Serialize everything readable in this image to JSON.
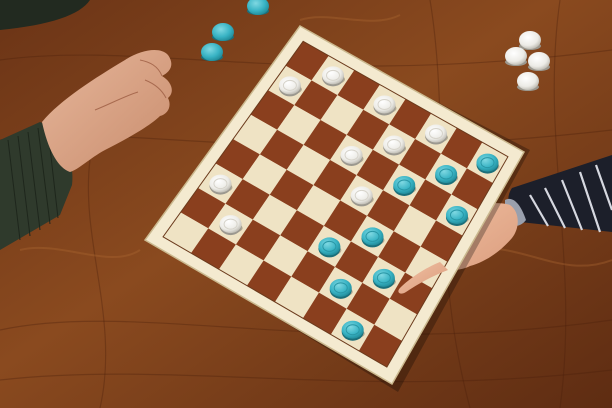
{
  "scene": {
    "description_free": true
  },
  "board": {
    "size": 8,
    "light_square_color": "#efe3c4",
    "dark_square_color": "#8a3f1e",
    "frame_color": "#f4ead0"
  },
  "pieces": {
    "white_color": "#f2f0ea",
    "teal_color": "#3bb8c8",
    "on_board": [
      {
        "side": "white",
        "row": 0,
        "col": 1
      },
      {
        "side": "white",
        "row": 0,
        "col": 3
      },
      {
        "side": "white",
        "row": 0,
        "col": 5
      },
      {
        "side": "white",
        "row": 1,
        "col": 0
      },
      {
        "side": "white",
        "row": 1,
        "col": 4
      },
      {
        "side": "white",
        "row": 2,
        "col": 3
      },
      {
        "side": "white",
        "row": 3,
        "col": 4
      },
      {
        "side": "white",
        "row": 5,
        "col": 0
      },
      {
        "side": "white",
        "row": 6,
        "col": 1
      },
      {
        "side": "teal",
        "row": 0,
        "col": 7
      },
      {
        "side": "teal",
        "row": 1,
        "col": 6
      },
      {
        "side": "teal",
        "row": 2,
        "col": 7
      },
      {
        "side": "teal",
        "row": 2,
        "col": 5
      },
      {
        "side": "teal",
        "row": 4,
        "col": 5
      },
      {
        "side": "teal",
        "row": 5,
        "col": 4
      },
      {
        "side": "teal",
        "row": 5,
        "col": 6
      },
      {
        "side": "teal",
        "row": 6,
        "col": 5
      },
      {
        "side": "teal",
        "row": 7,
        "col": 6
      }
    ]
  }
}
